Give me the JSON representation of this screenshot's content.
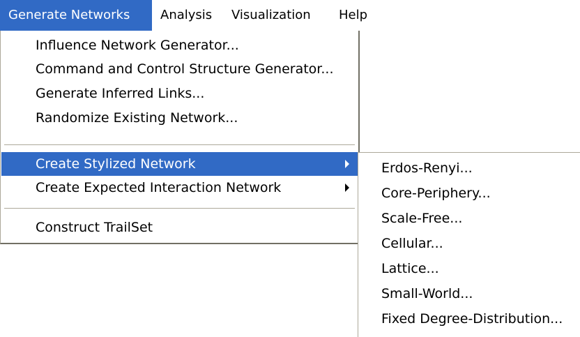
{
  "menubar": {
    "items": [
      {
        "label": "Generate Networks",
        "active": true
      },
      {
        "label": "Analysis"
      },
      {
        "label": "Visualization"
      },
      {
        "label": "Help"
      }
    ]
  },
  "dropdown": {
    "items": [
      {
        "label": "Influence Network Generator..."
      },
      {
        "label": "Command and Control Structure Generator..."
      },
      {
        "label": "Generate Inferred Links..."
      },
      {
        "label": "Randomize Existing Network..."
      },
      {
        "label": "Create Stylized Network",
        "has_submenu": true,
        "highlighted": true
      },
      {
        "label": "Create Expected Interaction Network",
        "has_submenu": true
      },
      {
        "label": "Construct TrailSet"
      }
    ]
  },
  "submenu": {
    "items": [
      {
        "label": "Erdos-Renyi..."
      },
      {
        "label": "Core-Periphery..."
      },
      {
        "label": "Scale-Free..."
      },
      {
        "label": "Cellular..."
      },
      {
        "label": "Lattice..."
      },
      {
        "label": "Small-World..."
      },
      {
        "label": "Fixed Degree-Distribution..."
      }
    ]
  },
  "colors": {
    "highlight": "#316ac5",
    "highlight_text": "#ffffff",
    "menu_background": "#ffffff",
    "border": "#aca899"
  }
}
